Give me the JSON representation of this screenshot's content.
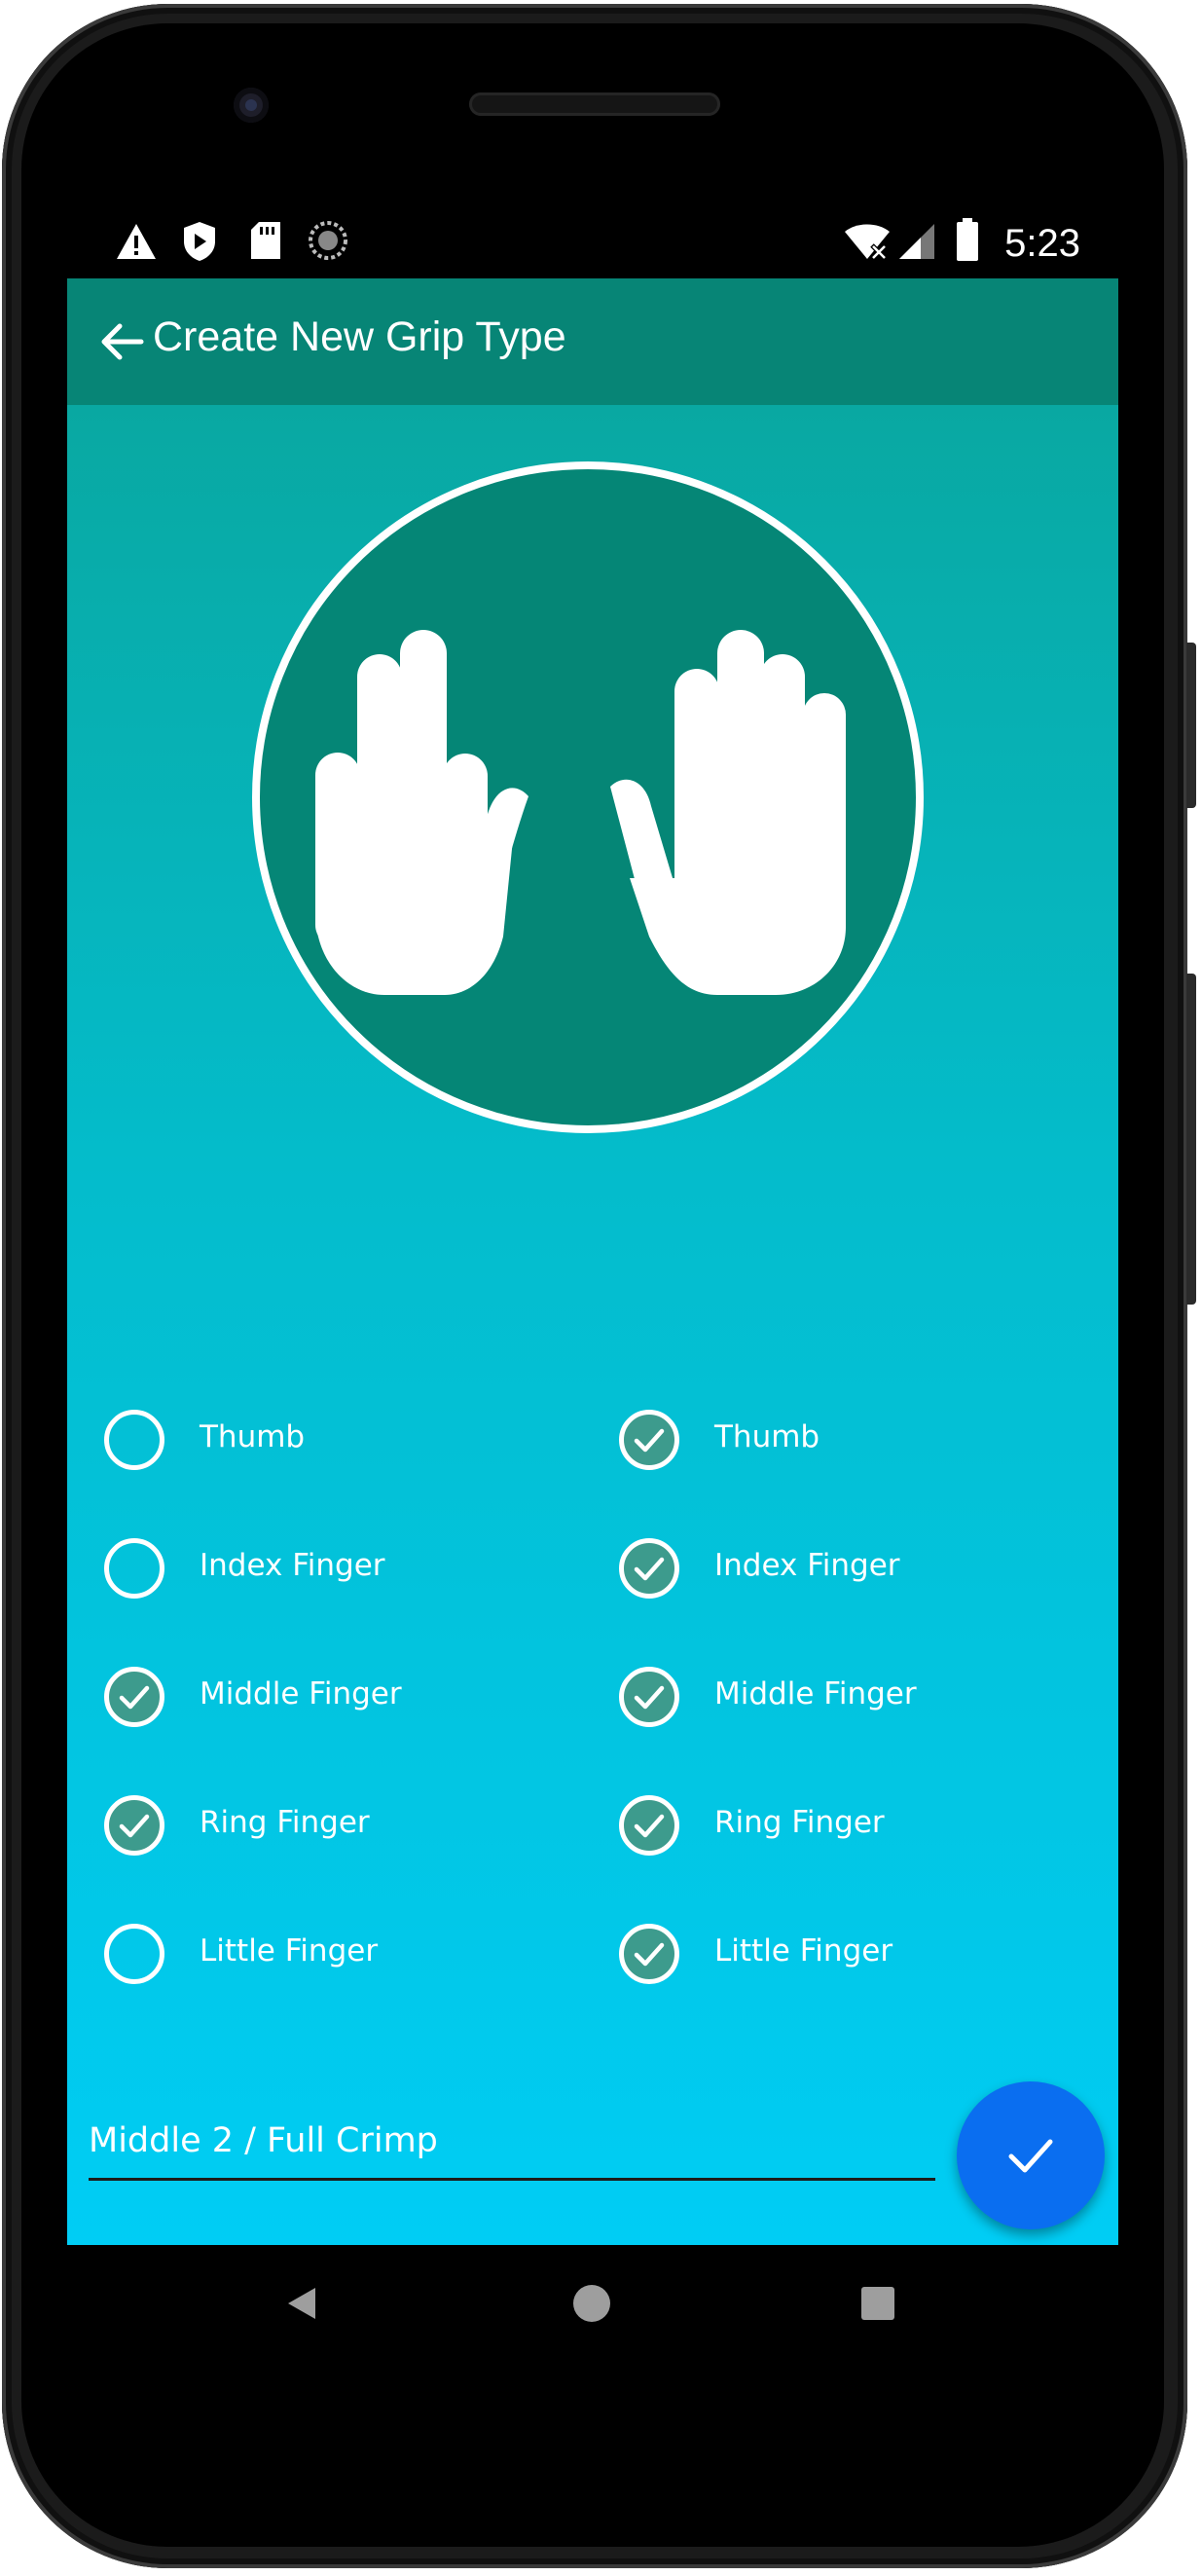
{
  "status_bar": {
    "time": "5:23",
    "left_icons": [
      "warning-icon",
      "shield-icon",
      "sd-card-icon",
      "sync-icon"
    ],
    "right_icons": [
      "wifi-off-icon",
      "cellular-signal-icon",
      "battery-icon"
    ]
  },
  "app_bar": {
    "title": "Create New Grip Type",
    "back_icon": "arrow-back-icon"
  },
  "hands": {
    "left_raised": [
      "Middle Finger",
      "Ring Finger"
    ],
    "right_raised": [
      "Thumb",
      "Index Finger",
      "Middle Finger",
      "Ring Finger",
      "Little Finger"
    ]
  },
  "left_hand": [
    {
      "label": "Thumb",
      "checked": false
    },
    {
      "label": "Index Finger",
      "checked": false
    },
    {
      "label": "Middle Finger",
      "checked": true
    },
    {
      "label": "Ring Finger",
      "checked": true
    },
    {
      "label": "Little Finger",
      "checked": false
    }
  ],
  "right_hand": [
    {
      "label": "Thumb",
      "checked": true
    },
    {
      "label": "Index Finger",
      "checked": true
    },
    {
      "label": "Middle Finger",
      "checked": true
    },
    {
      "label": "Ring Finger",
      "checked": true
    },
    {
      "label": "Little Finger",
      "checked": true
    }
  ],
  "grip_name": {
    "value": "Middle 2 / Full Crimp",
    "placeholder": ""
  },
  "fab": {
    "icon": "check-icon"
  },
  "nav_bar": {
    "buttons": [
      "back-triangle-icon",
      "home-circle-icon",
      "recents-square-icon"
    ]
  },
  "colors": {
    "app_bar": "#078576",
    "circle": "#058676",
    "checked_fill": "#3d9b8d",
    "fab": "#0a6ef0",
    "gradient_top": "#0aa59b",
    "gradient_bottom": "#00cdf5"
  }
}
